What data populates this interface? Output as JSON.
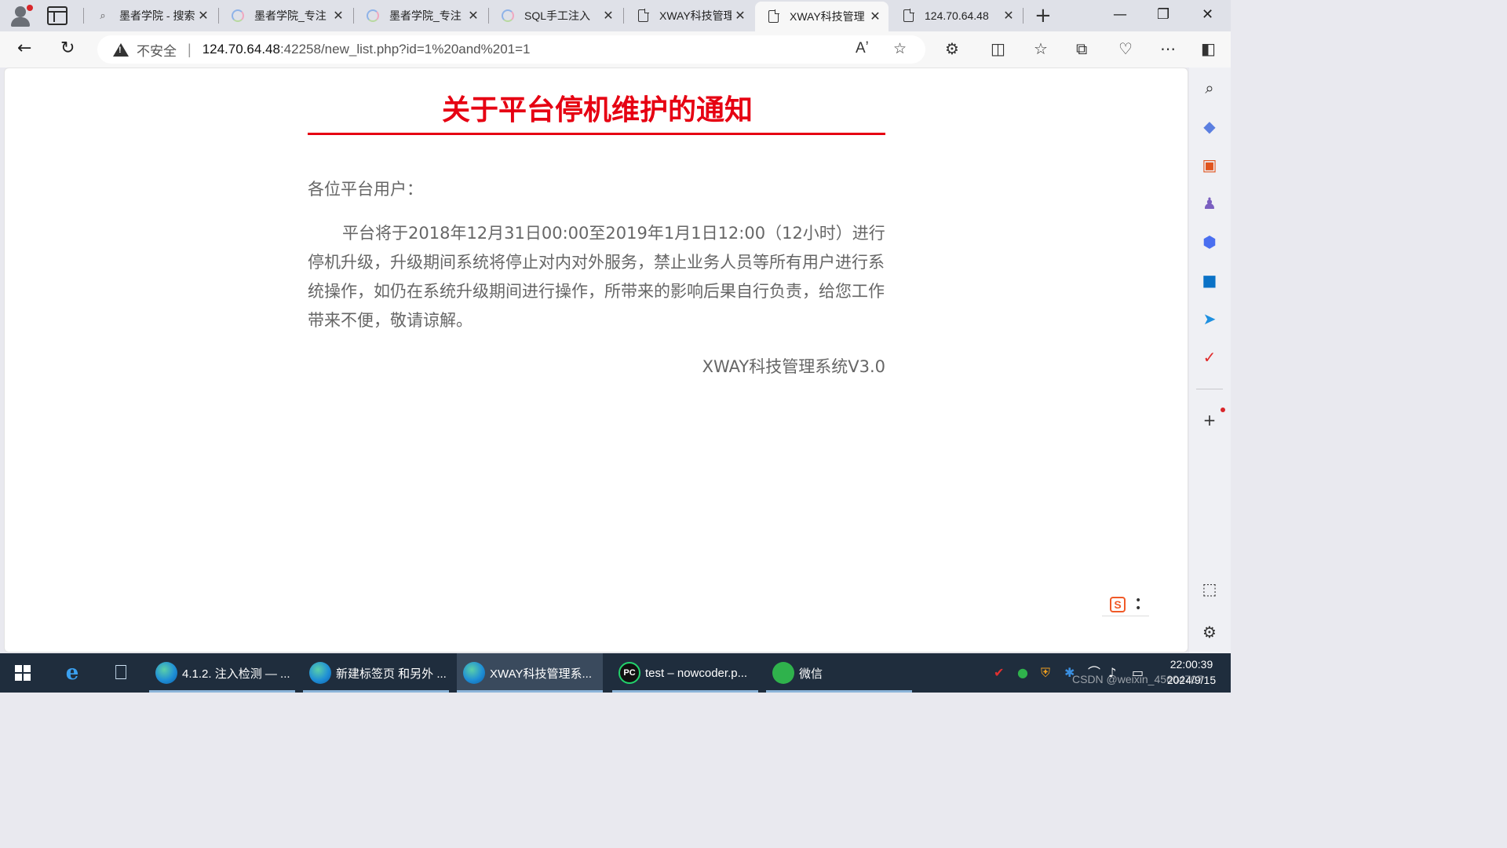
{
  "browser": {
    "tabs": [
      {
        "title": "墨者学院 - 搜索",
        "icon": "search-icon",
        "close": "✕"
      },
      {
        "title": "墨者学院_专注",
        "icon": "mozhe-logo-icon",
        "close": "✕"
      },
      {
        "title": "墨者学院_专注",
        "icon": "mozhe-logo-icon",
        "close": "✕"
      },
      {
        "title": "SQL手工注入",
        "icon": "mozhe-logo-icon",
        "close": "✕"
      },
      {
        "title": "XWAY科技管理",
        "icon": "page-icon",
        "close": "✕"
      },
      {
        "title": "XWAY科技管理",
        "icon": "page-icon",
        "close": "✕",
        "active": true
      },
      {
        "title": "124.70.64.48",
        "icon": "page-icon",
        "close": "✕"
      }
    ],
    "new_tab": "+",
    "window_controls": {
      "minimize": "—",
      "restore": "❐",
      "close": "✕"
    },
    "address": {
      "security_label": "不安全",
      "separator": "|",
      "url_host": "124.70.64.48",
      "url_rest": ":42258/new_list.php?id=1%20and%201=1"
    }
  },
  "page": {
    "title": "关于平台停机维护的通知",
    "greeting": "各位平台用户：",
    "body": "平台将于2018年12月31日00:00至2019年1月1日12:00（12小时）进行停机升级，升级期间系统将停止对内对外服务，禁止业务人员等所有用户进行系统操作，如仍在系统升级期间进行操作，所带来的影响后果自行负责，给您工作带来不便，敬请谅解。",
    "signature": "XWAY科技管理系统V3.0",
    "widget_logo": "S"
  },
  "taskbar": {
    "tasks": [
      {
        "label": "4.1.2. 注入检测 — ...",
        "icon": "edge-icon"
      },
      {
        "label": "新建标签页 和另外 ...",
        "icon": "edge-icon"
      },
      {
        "label": "XWAY科技管理系...",
        "icon": "edge-icon",
        "active": true
      },
      {
        "label": "test – nowcoder.p...",
        "icon": "pycharm-icon"
      },
      {
        "label": "微信",
        "icon": "wechat-icon"
      }
    ],
    "clock_time": "22:00:39",
    "clock_date": "2024/9/15",
    "pycharm_letters": "PC"
  },
  "overlay": {
    "watermark": "CSDN @weixin_45604707"
  },
  "colors": {
    "title_red": "#e60012",
    "taskbar_bg": "#1f2d3d"
  }
}
